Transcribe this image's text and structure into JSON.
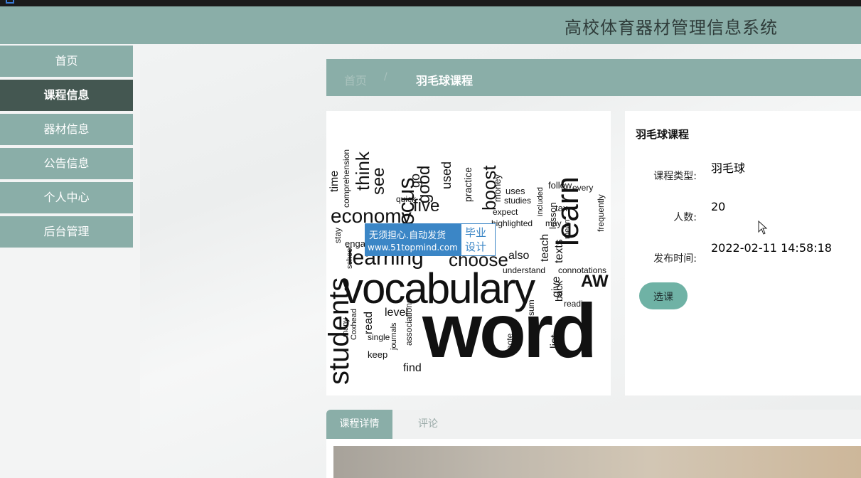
{
  "header": {
    "title": "高校体育器材管理信息系统"
  },
  "nav": {
    "items": [
      {
        "label": "首页"
      },
      {
        "label": "课程信息"
      },
      {
        "label": "器材信息"
      },
      {
        "label": "公告信息"
      },
      {
        "label": "个人中心"
      },
      {
        "label": "后台管理"
      }
    ],
    "active_index": 1
  },
  "breadcrumb": {
    "home": "首页",
    "separator": "/",
    "current": "羽毛球课程"
  },
  "watermark": {
    "line1": "无须担心.自动发货",
    "line2": "www.51topmind.com",
    "right": "毕业设计"
  },
  "course": {
    "title": "羽毛球课程",
    "type_label": "课程类型:",
    "type_value": "羽毛球",
    "count_label": "人数:",
    "count_value": "20",
    "time_label": "发布时间:",
    "time_value": "2022-02-11 14:58:18",
    "select_button": "选课"
  },
  "tabs": [
    {
      "label": "课程详情"
    },
    {
      "label": "评论"
    }
  ],
  "wordcloud": [
    "word",
    "vocabulary",
    "learning",
    "choose",
    "learn",
    "students",
    "economy",
    "five",
    "good",
    "focus",
    "think",
    "see",
    "used",
    "boost",
    "practice",
    "money",
    "uses",
    "studies",
    "follow",
    "every",
    "tax",
    "lesson",
    "included",
    "texts",
    "teach",
    "also",
    "give",
    "back",
    "reading",
    "level",
    "read",
    "journals",
    "associations",
    "note",
    "list",
    "find",
    "keep",
    "single",
    "Coxhead",
    "many",
    "school",
    "quick",
    "go",
    "time",
    "comprehension",
    "expect",
    "highlighted",
    "may",
    "mean",
    "frequently",
    "understand",
    "connotations",
    "sum",
    "AW",
    "stay",
    "engage"
  ],
  "colors": {
    "header": "#8aaea8",
    "nav_active": "#445751",
    "accent_button": "#6fb2a5",
    "watermark_blue": "#3b86c6"
  }
}
